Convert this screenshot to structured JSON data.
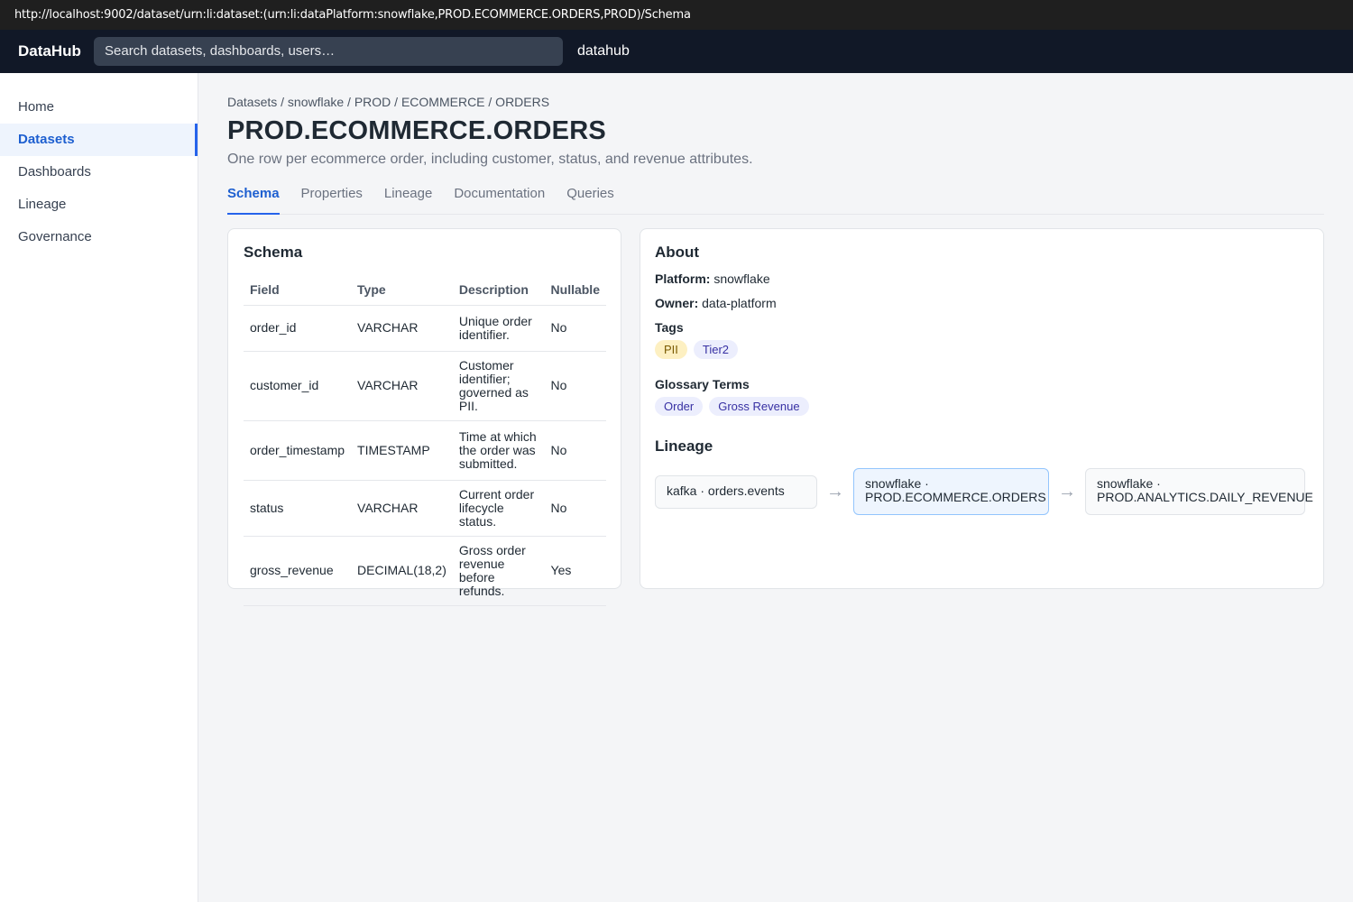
{
  "browser": {
    "url": "http://localhost:9002/dataset/urn:li:dataset:(urn:li:dataPlatform:snowflake,PROD.ECOMMERCE.ORDERS,PROD)/Schema"
  },
  "topnav": {
    "brand": "DataHub",
    "search_placeholder": "Search datasets, dashboards, users…",
    "user": "datahub"
  },
  "sidebar": {
    "items": [
      {
        "label": "Home",
        "active": false
      },
      {
        "label": "Datasets",
        "active": true
      },
      {
        "label": "Dashboards",
        "active": false
      },
      {
        "label": "Lineage",
        "active": false
      },
      {
        "label": "Governance",
        "active": false
      }
    ]
  },
  "dataset": {
    "breadcrumb": "Datasets / snowflake / PROD / ECOMMERCE / ORDERS",
    "title": "PROD.ECOMMERCE.ORDERS",
    "description": "One row per ecommerce order, including customer, status, and revenue attributes."
  },
  "tabs": [
    {
      "label": "Schema",
      "active": true
    },
    {
      "label": "Properties",
      "active": false
    },
    {
      "label": "Lineage",
      "active": false
    },
    {
      "label": "Documentation",
      "active": false
    },
    {
      "label": "Queries",
      "active": false
    }
  ],
  "schema": {
    "title": "Schema",
    "columns": [
      "Field",
      "Type",
      "Description",
      "Nullable"
    ],
    "rows": [
      {
        "field": "order_id",
        "type": "VARCHAR",
        "description": "Unique order identifier.",
        "nullable": "No"
      },
      {
        "field": "customer_id",
        "type": "VARCHAR",
        "description": "Customer identifier; governed as PII.",
        "nullable": "No"
      },
      {
        "field": "order_timestamp",
        "type": "TIMESTAMP",
        "description": "Time at which the order was submitted.",
        "nullable": "No"
      },
      {
        "field": "status",
        "type": "VARCHAR",
        "description": "Current order lifecycle status.",
        "nullable": "No"
      },
      {
        "field": "gross_revenue",
        "type": "DECIMAL(18,2)",
        "description": "Gross order revenue before refunds.",
        "nullable": "Yes"
      }
    ]
  },
  "about": {
    "title": "About",
    "platform_label": "Platform:",
    "platform": "snowflake",
    "owner_label": "Owner:",
    "owner": "data-platform",
    "tags_label": "Tags",
    "tags": [
      "PII",
      "Tier2"
    ],
    "terms_label": "Glossary Terms",
    "terms": [
      "Order",
      "Gross Revenue"
    ],
    "lineage_title": "Lineage",
    "lineage": {
      "upstream": "kafka · orders.events",
      "current": "snowflake · PROD.ECOMMERCE.ORDERS",
      "downstream": "snowflake · PROD.ANALYTICS.DAILY_REVENUE",
      "arrow": "→"
    }
  },
  "colors": {
    "accent": "#2563eb",
    "nav_bg": "#111827",
    "pii_chip": "#fdf0c2",
    "term_chip": "#eceefd"
  }
}
